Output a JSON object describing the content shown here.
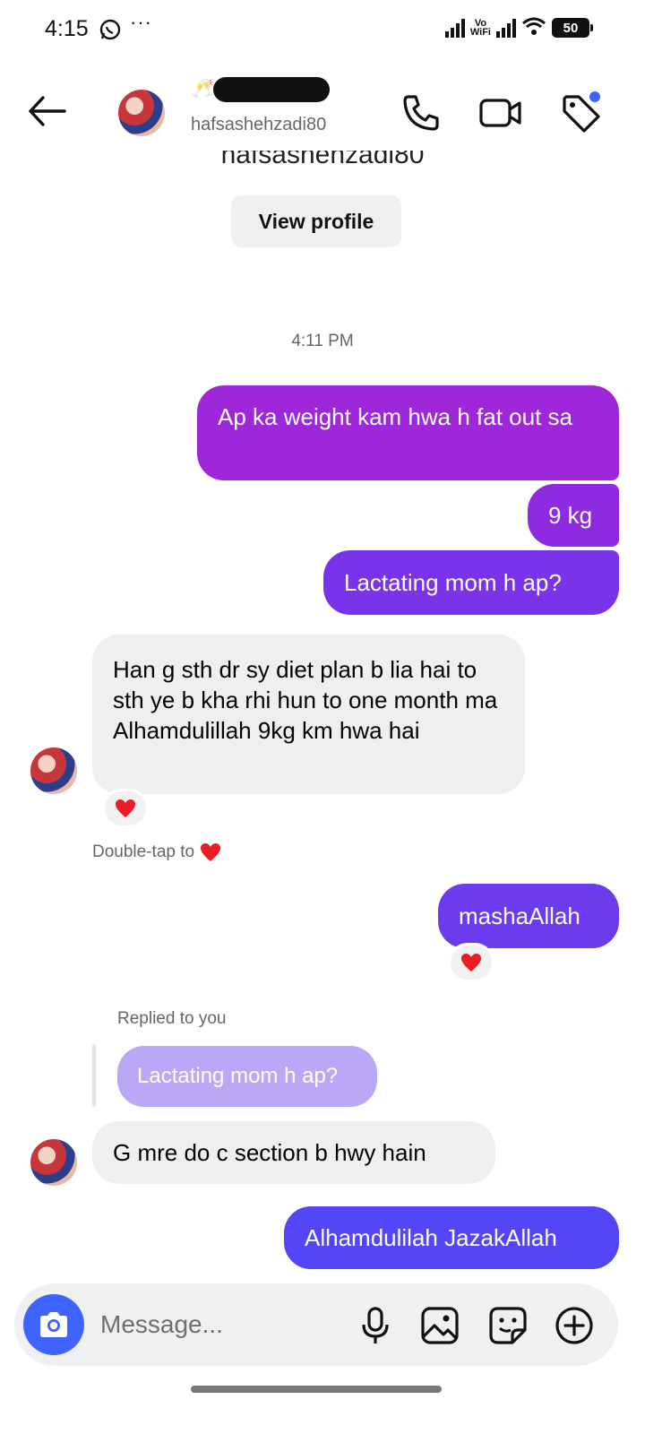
{
  "status_bar": {
    "time": "4:15",
    "battery": "50",
    "vowifi_top": "Vo",
    "vowifi_bottom": "WiFi",
    "more": "···"
  },
  "header": {
    "username": "hafsashehzadi80",
    "name_emoji": "🥂"
  },
  "profile": {
    "cut_username": "hafsashehzadi80",
    "view_profile_label": "View profile"
  },
  "messages": [
    {
      "timestamp": "4:11 PM"
    },
    {
      "from": "me",
      "text": "Ap ka weight kam hwa h fat out sa"
    },
    {
      "from": "me",
      "text": "9 kg"
    },
    {
      "from": "me",
      "text": "Lactating mom h ap?"
    },
    {
      "from": "them",
      "text": "Han g sth dr sy diet plan b lia hai to sth ye b kha rhi hun to one month ma Alhamdulillah 9kg km hwa hai",
      "reaction": "❤️"
    },
    {
      "hint": "Double-tap to",
      "hint_emoji": "❤️"
    },
    {
      "from": "me",
      "text": "mashaAllah",
      "reaction": "❤️"
    },
    {
      "from": "them",
      "replied_label": "Replied to you",
      "quoted": "Lactating mom h ap?",
      "text": "G mre do c section b hwy hain"
    },
    {
      "from": "me",
      "text": "Alhamdulilah JazakAllah"
    }
  ],
  "composer": {
    "placeholder": "Message..."
  },
  "colors": {
    "accent": "#3e63ff",
    "bubble_purple": "#9e28d9",
    "bubble_blue": "#5246f6",
    "incoming": "#efefef"
  },
  "icons": [
    "back-arrow-icon",
    "phone-icon",
    "video-camera-icon",
    "tag-icon",
    "camera-icon",
    "microphone-icon",
    "gallery-icon",
    "sticker-icon",
    "plus-icon",
    "whatsapp-icon"
  ]
}
